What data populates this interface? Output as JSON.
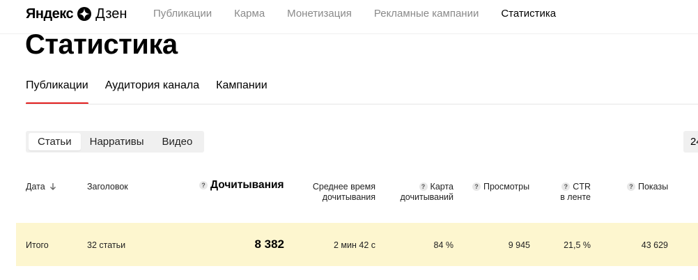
{
  "header": {
    "logo_brand": "Яндекс",
    "logo_product": "Дзен",
    "nav": [
      "Публикации",
      "Карма",
      "Монетизация",
      "Рекламные кампании",
      "Статистика"
    ],
    "active_nav": "Статистика"
  },
  "page": {
    "title": "Статистика"
  },
  "tabs": [
    "Публикации",
    "Аудитория канала",
    "Кампании"
  ],
  "content_types": [
    "Статьи",
    "Нарративы",
    "Видео"
  ],
  "period_partial": "24",
  "table": {
    "headers": {
      "date": "Дата",
      "title": "Заголовок",
      "readthroughs": "Дочитывания",
      "avg_time_line1": "Среднее время",
      "avg_time_line2": "дочитывания",
      "map_line1": "Карта",
      "map_line2": "дочитываний",
      "views": "Просмотры",
      "ctr_line1": "CTR",
      "ctr_line2": "в ленте",
      "impressions": "Показы"
    },
    "total": {
      "label": "Итого",
      "title": "32 статьи",
      "readthroughs": "8 382",
      "avg_time": "2 мин 42 с",
      "map": "84 %",
      "views": "9 945",
      "ctr": "21,5 %",
      "impressions": "43 629"
    }
  },
  "colors": {
    "accent": "#e21f1f",
    "total_row_bg": "#fdf6cf",
    "nav_inactive": "#8a8a8a"
  }
}
